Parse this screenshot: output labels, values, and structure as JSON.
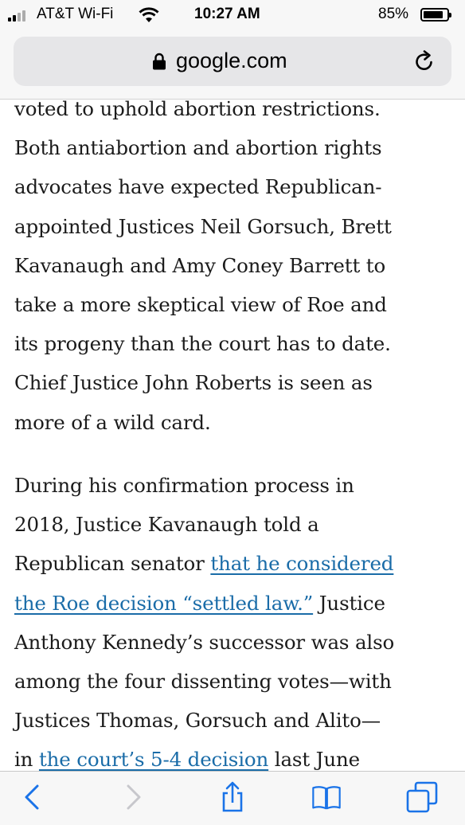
{
  "status_bar": {
    "carrier": "AT&T Wi-Fi",
    "time": "10:27 AM",
    "battery_percent": "85%",
    "battery_level": 0.85,
    "signal_bars": 2,
    "icons": [
      "signal-icon",
      "wifi-icon",
      "battery-icon"
    ]
  },
  "address_bar": {
    "url": "google.com",
    "icons": [
      "lock-icon",
      "reload-icon"
    ]
  },
  "article": {
    "paragraph1": [
      "voted to uphold abortion restrictions.",
      "Both antiabortion and abortion rights",
      "advocates have expected Republican-",
      "appointed Justices Neil Gorsuch, Brett",
      "Kavanaugh and Amy Coney Barrett to",
      "take a more skeptical view of Roe and",
      "its progeny than the court has to date.",
      "Chief Justice John Roberts is seen as",
      "more of a wild card."
    ],
    "paragraph2": {
      "line1": "During his confirmation process in",
      "line2": "2018, Justice Kavanaugh told a",
      "line3_text": "Republican senator ",
      "line3_link": "that he considered",
      "line4_link": "the Roe decision “settled law.”",
      "line4_text": " Justice",
      "line5": "Anthony Kennedy’s successor was also",
      "line6": "among the four dissenting votes—with",
      "line7": "Justices Thomas, Gorsuch and Alito—",
      "line8_text1": "in ",
      "line8_link": "the court’s 5-4 decision",
      "line8_text2": " last June"
    }
  },
  "toolbar": {
    "icons": [
      "back-icon",
      "forward-icon",
      "share-icon",
      "bookmarks-icon",
      "tabs-icon"
    ],
    "accent_color": "#1a73e8",
    "disabled_color": "#c7c7cc"
  }
}
